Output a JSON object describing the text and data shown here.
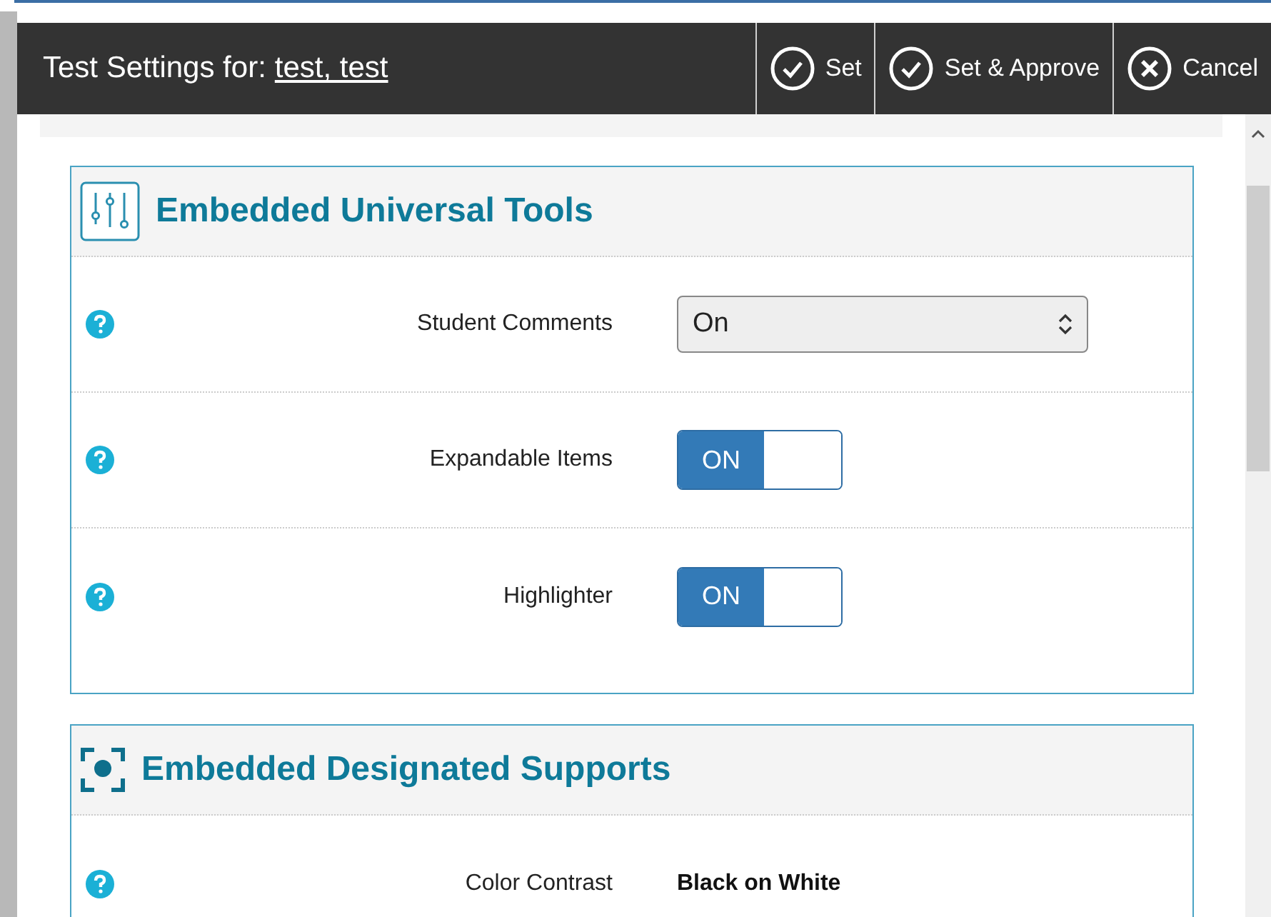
{
  "dialog": {
    "title": "Test Settings for:",
    "student": "test, test"
  },
  "actions": [
    {
      "kind": "check",
      "label": "Set"
    },
    {
      "kind": "check",
      "label": "Set & Approve"
    },
    {
      "kind": "cancel",
      "label": "Cancel"
    }
  ],
  "sections": [
    {
      "title": "Embedded Universal Tools",
      "kind": "sliders",
      "settings": [
        {
          "kind": "select",
          "label": "Student Comments",
          "value": "On"
        },
        {
          "kind": "toggle",
          "label": "Expandable Items",
          "on": true,
          "text": "ON"
        },
        {
          "kind": "toggle",
          "label": "Highlighter",
          "on": true,
          "text": "ON"
        }
      ]
    },
    {
      "title": "Embedded Designated Supports",
      "kind": "focus",
      "settings": [
        {
          "kind": "value",
          "label": "Color Contrast",
          "value": "Black on White"
        }
      ]
    }
  ]
}
